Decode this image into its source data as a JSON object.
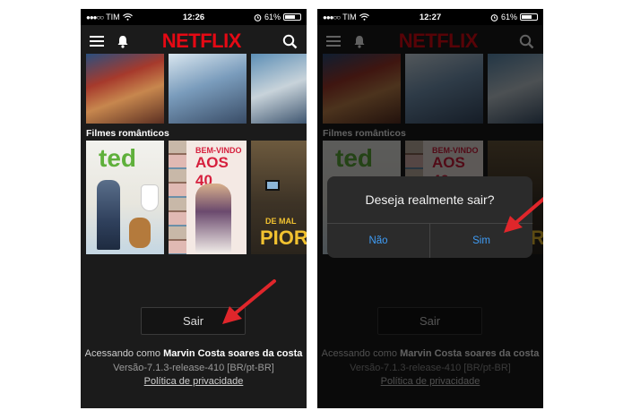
{
  "status_left": {
    "carrier": "TIM",
    "time": "12:26",
    "battery": "61%"
  },
  "status_right": {
    "carrier": "TIM",
    "time": "12:27",
    "battery": "61%"
  },
  "header": {
    "logo": "NETFLIX"
  },
  "section": {
    "title": "Filmes românticos"
  },
  "posters_row2": {
    "ted_title": "ted",
    "bemvindo_line1": "BEM-VINDO",
    "bemvindo_line2": "AOS 40",
    "pior_line1": "DE MAL",
    "pior_line2": "PIOR"
  },
  "account": {
    "sair_label": "Sair",
    "accessing_prefix": "Acessando como",
    "user_name": "Marvin Costa soares da costa",
    "version": "Versão-7.1.3-release-410 [BR/pt-BR]",
    "privacy_link": "Política de privacidade"
  },
  "dialog": {
    "question": "Deseja realmente sair?",
    "no_label": "Não",
    "yes_label": "Sim"
  },
  "colors": {
    "netflix_red": "#e50914",
    "dialog_link_blue": "#3f9cf5",
    "arrow_red": "#e0262b",
    "background": "#1b1b1b"
  },
  "icons": {
    "menu": "hamburger-icon",
    "notifications": "bell-icon",
    "search": "search-icon",
    "wifi": "wifi-icon",
    "alarm": "alarm-icon",
    "battery": "battery-icon",
    "annotation": "arrow-icon"
  }
}
